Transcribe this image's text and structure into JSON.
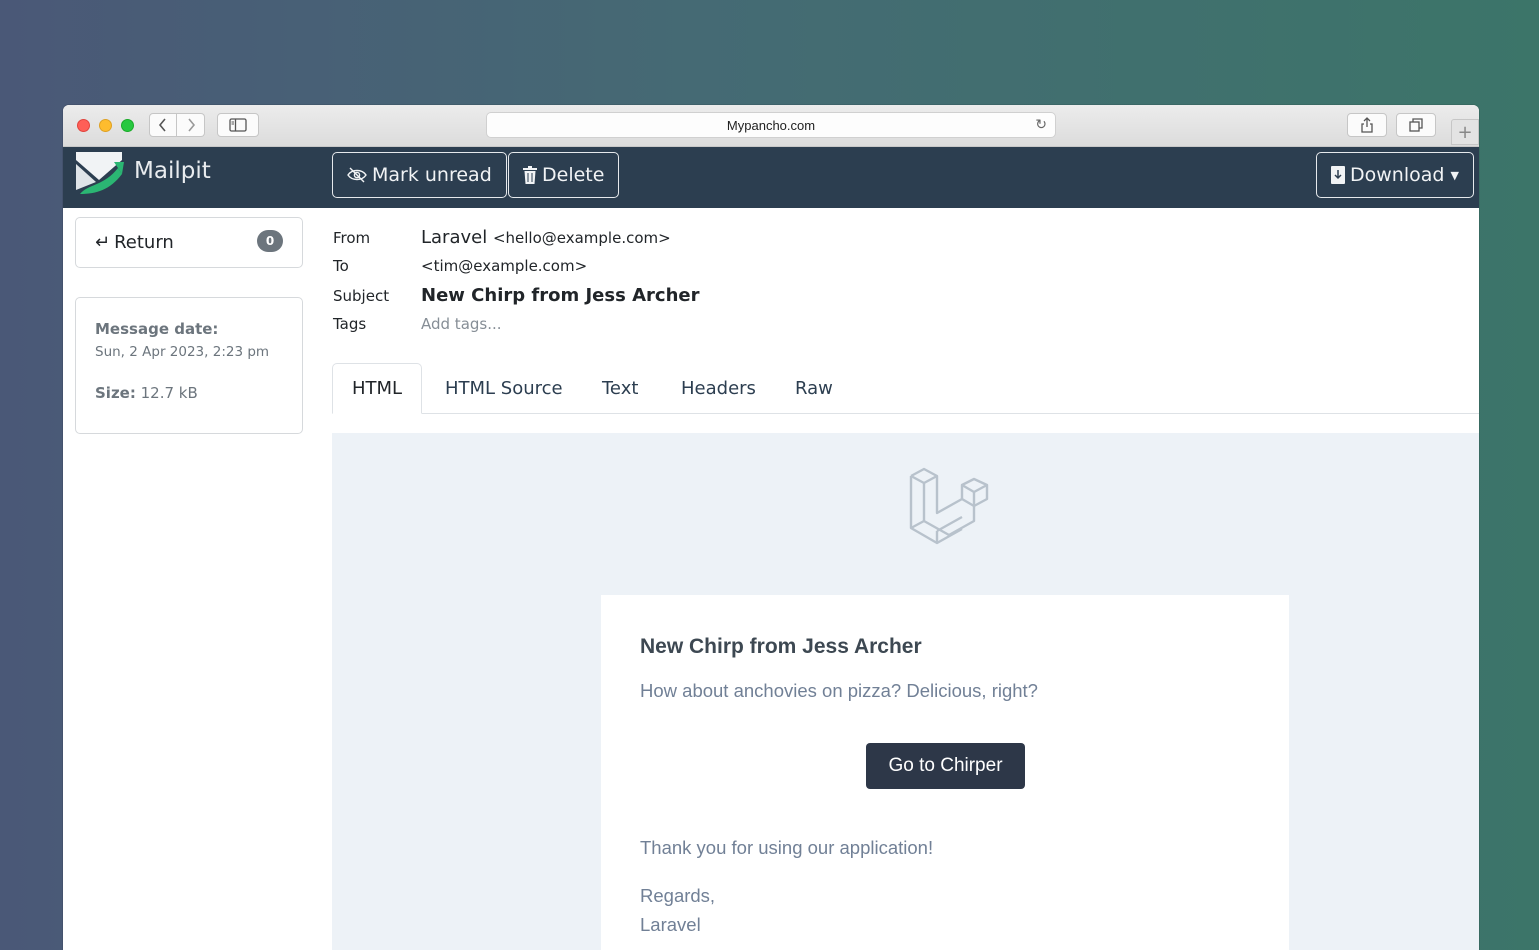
{
  "browser": {
    "url": "Mypancho.com",
    "icons": {
      "back": "chevron-left-icon",
      "forward": "chevron-right-icon",
      "sidebar": "sidebar-icon",
      "reload": "reload-icon",
      "share": "share-icon",
      "tabs": "tabs-icon",
      "new_tab": "plus-icon"
    }
  },
  "navbar": {
    "brand": "Mailpit",
    "mark_unread": "Mark unread",
    "delete": "Delete",
    "download": "Download",
    "colors": {
      "bg": "#2c3e50",
      "brand_green": "#2bb673"
    }
  },
  "sidebar": {
    "return_label": "Return",
    "unread_count": "0",
    "message_date_label": "Message date:",
    "message_date": "Sun, 2 Apr 2023, 2:23 pm",
    "size_label": "Size:",
    "size_value": "12.7 kB"
  },
  "message": {
    "from_label": "From",
    "from_name": "Laravel",
    "from_address": "<hello@example.com>",
    "to_label": "To",
    "to_address": "<tim@example.com>",
    "subject_label": "Subject",
    "subject": "New Chirp from Jess Archer",
    "tags_label": "Tags",
    "tags_placeholder": "Add tags..."
  },
  "tabs": [
    {
      "label": "HTML",
      "active": true
    },
    {
      "label": "HTML Source",
      "active": false
    },
    {
      "label": "Text",
      "active": false
    },
    {
      "label": "Headers",
      "active": false
    },
    {
      "label": "Raw",
      "active": false
    }
  ],
  "email_body": {
    "heading": "New Chirp from Jess Archer",
    "intro": "How about anchovies on pizza? Delicious, right?",
    "button": "Go to Chirper",
    "thanks": "Thank you for using our application!",
    "regards": "Regards,",
    "signature": "Laravel"
  }
}
